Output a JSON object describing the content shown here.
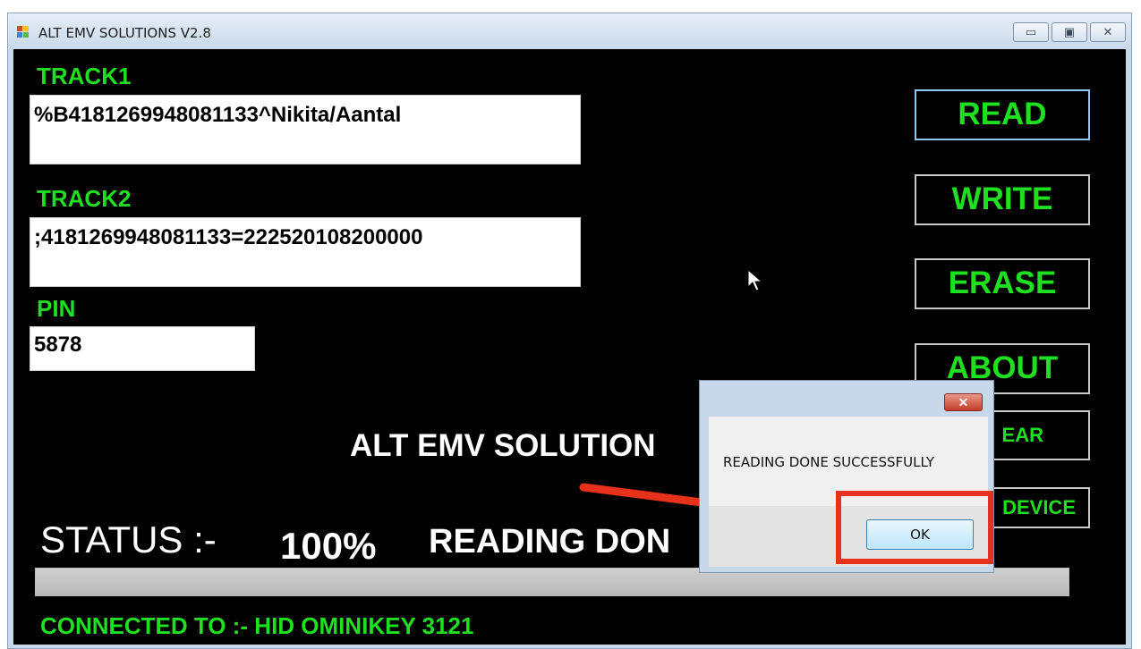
{
  "window": {
    "title": "ALT EMV SOLUTIONS V2.8",
    "minimize_glyph": "▭",
    "maximize_glyph": "▣",
    "close_glyph": "✕"
  },
  "tracks": {
    "track1_label": "TRACK1",
    "track1_value": "%B4181269948081133^Nikita/Aantal",
    "track2_label": "TRACK2",
    "track2_value": ";4181269948081133=222520108200000",
    "pin_label": "PIN",
    "pin_value": "5878"
  },
  "buttons": {
    "read": "READ",
    "write": "WRITE",
    "erase": "ERASE",
    "about": "ABOUT",
    "clear": "EAR",
    "device": "DEVICE"
  },
  "brand_text": "ALT EMV SOLUTION",
  "status": {
    "label": "STATUS :-",
    "percent_text": "100%",
    "message": "READING DON",
    "progress": 1.0
  },
  "connection": "CONNECTED TO :- HID OMINIKEY 3121",
  "dialog": {
    "close_glyph": "✕",
    "message": "READING DONE SUCCESSFULLY",
    "ok_label": "OK"
  },
  "colors": {
    "accent_green": "#1fe020",
    "annotation_red": "#e8311a"
  }
}
